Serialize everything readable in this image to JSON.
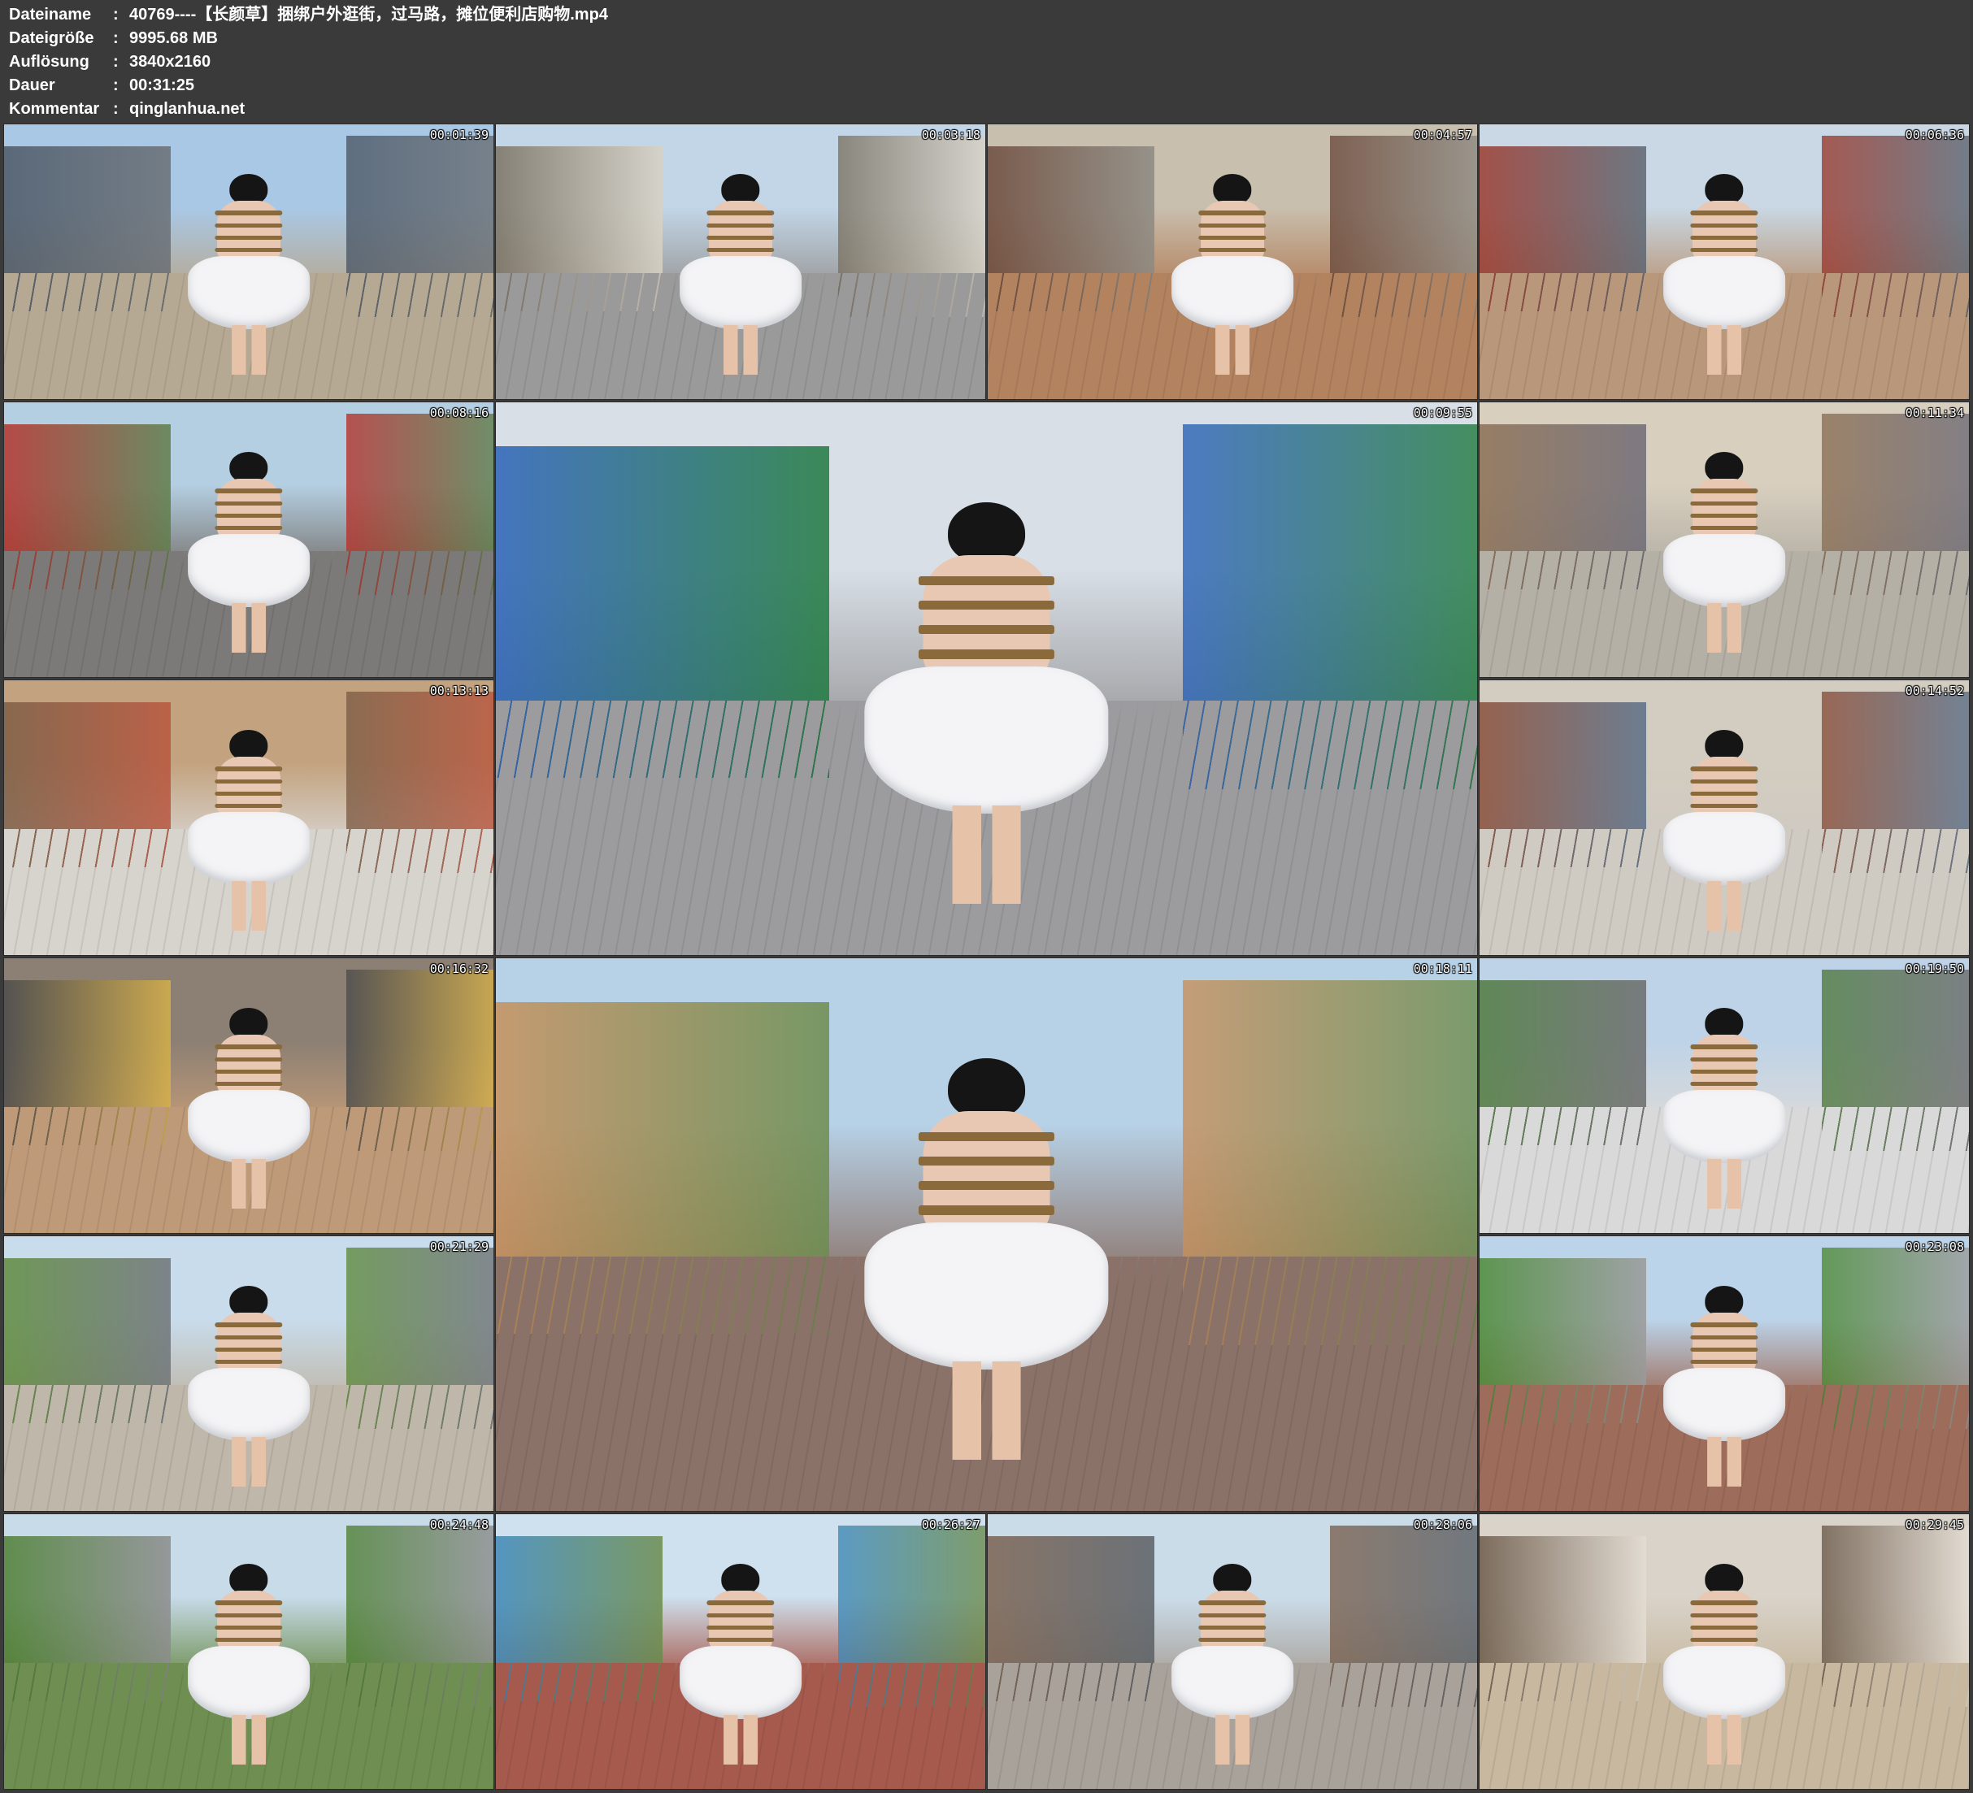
{
  "header": {
    "rows": [
      {
        "key": "Dateiname",
        "sep": ":",
        "value": "40769----【长颜草】捆绑户外逛街，过马路，摊位便利店购物.mp4"
      },
      {
        "key": "Dateigröße",
        "sep": ":",
        "value": "9995.68 MB"
      },
      {
        "key": "Auflösung",
        "sep": ":",
        "value": "3840x2160"
      },
      {
        "key": "Dauer",
        "sep": ":",
        "value": "00:31:25"
      },
      {
        "key": "Kommentar",
        "sep": ":",
        "value": "qinglanhua.net"
      }
    ]
  },
  "thumbnails": [
    {
      "time": "00:01:39",
      "palette": [
        "#a9c8e6",
        "#b6a994",
        "#4c5866",
        "#6a6f74"
      ]
    },
    {
      "time": "00:03:18",
      "palette": [
        "#c2d6e8",
        "#9a9a9a",
        "#7b7262",
        "#d9d2c4"
      ]
    },
    {
      "time": "00:04:57",
      "palette": [
        "#c9bfae",
        "#b3825f",
        "#6b4a3c",
        "#8d8a83"
      ]
    },
    {
      "time": "00:06:36",
      "palette": [
        "#c9d8e4",
        "#b9977a",
        "#9b3a2f",
        "#5d6671"
      ]
    },
    {
      "time": "00:08:16",
      "palette": [
        "#b4cfe2",
        "#7c7a78",
        "#b5322b",
        "#5f7d4a"
      ]
    },
    {
      "time": "00:09:55",
      "palette": [
        "#d8dfe6",
        "#9c9c9f",
        "#2a62b8",
        "#1f7a3f"
      ]
    },
    {
      "time": "00:11:34",
      "palette": [
        "#d8cfbe",
        "#b5b0a6",
        "#8b6f55",
        "#6e6b76"
      ]
    },
    {
      "time": "00:13:13",
      "palette": [
        "#c3a27f",
        "#d7d3cd",
        "#7d5e46",
        "#b9563e"
      ]
    },
    {
      "time": "00:14:52",
      "palette": [
        "#d3ccc0",
        "#cfcac2",
        "#8a4f3b",
        "#5b6f88"
      ]
    },
    {
      "time": "00:16:32",
      "palette": [
        "#8c7f73",
        "#bf9a78",
        "#4b4b4b",
        "#d6b04a"
      ]
    },
    {
      "time": "00:18:11",
      "palette": [
        "#b7d1e6",
        "#8a7268",
        "#c7905c",
        "#6c8d4e"
      ]
    },
    {
      "time": "00:19:50",
      "palette": [
        "#bed3e7",
        "#d9d9d9",
        "#4f7a3e",
        "#6b6b6b"
      ]
    },
    {
      "time": "00:21:29",
      "palette": [
        "#c9dcec",
        "#bfb7a9",
        "#5f8b3d",
        "#6f7478"
      ]
    },
    {
      "time": "00:23:08",
      "palette": [
        "#bcd4ea",
        "#9d6c5a",
        "#4d8a36",
        "#9a9a9a"
      ]
    },
    {
      "time": "00:24:48",
      "palette": [
        "#c7dbe9",
        "#6f8f52",
        "#4e7f33",
        "#8c8c8c"
      ]
    },
    {
      "time": "00:26:27",
      "palette": [
        "#cfe0ee",
        "#a65a4d",
        "#3f89b8",
        "#6a8c4c"
      ]
    },
    {
      "time": "00:28:06",
      "palette": [
        "#cbdce9",
        "#a8a29b",
        "#7b6250",
        "#5a5f64"
      ]
    },
    {
      "time": "00:29:45",
      "palette": [
        "#d9d3ca",
        "#c7b89f",
        "#6b5a4a",
        "#e4ddd3"
      ]
    }
  ]
}
